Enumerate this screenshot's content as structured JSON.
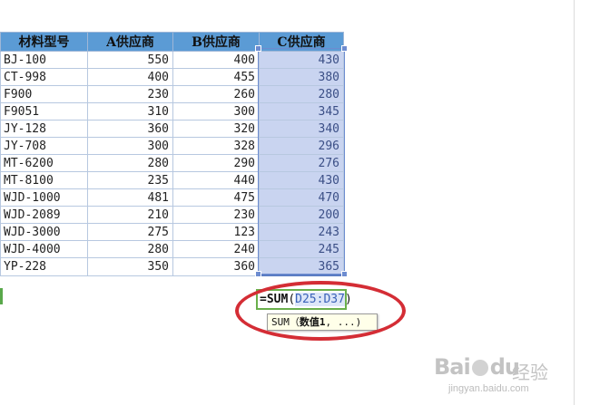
{
  "table": {
    "headers": [
      "材料型号",
      "A供应商",
      "B供应商",
      "C供应商"
    ],
    "rows": [
      [
        "BJ-100",
        "550",
        "400",
        "430"
      ],
      [
        "CT-998",
        "400",
        "455",
        "380"
      ],
      [
        "F900",
        "230",
        "260",
        "280"
      ],
      [
        "F9051",
        "310",
        "300",
        "345"
      ],
      [
        "JY-128",
        "360",
        "320",
        "340"
      ],
      [
        "JY-708",
        "300",
        "328",
        "296"
      ],
      [
        "MT-6200",
        "280",
        "290",
        "276"
      ],
      [
        "MT-8100",
        "235",
        "440",
        "430"
      ],
      [
        "WJD-1000",
        "481",
        "475",
        "470"
      ],
      [
        "WJD-2089",
        "210",
        "230",
        "200"
      ],
      [
        "WJD-3000",
        "275",
        "123",
        "243"
      ],
      [
        "WJD-4000",
        "280",
        "240",
        "245"
      ],
      [
        "YP-228",
        "350",
        "360",
        "365"
      ]
    ]
  },
  "formula": {
    "prefix": "=SUM",
    "open_paren": "(",
    "range_ref": "D25:D37",
    "close_paren": ")"
  },
  "tooltip": {
    "func": "SUM",
    "open": "（",
    "arg": "数值1",
    "rest": ", ...)"
  },
  "watermark": {
    "logo_left": "Bai",
    "logo_right": "经验",
    "url": "jingyan.baidu.com",
    "mid": "du"
  },
  "colors": {
    "header_bg": "#5b9bd5",
    "selection_bg": "#c9d4f0",
    "highlight_ring": "#d42d35",
    "active_cell_border": "#6ab04c"
  }
}
